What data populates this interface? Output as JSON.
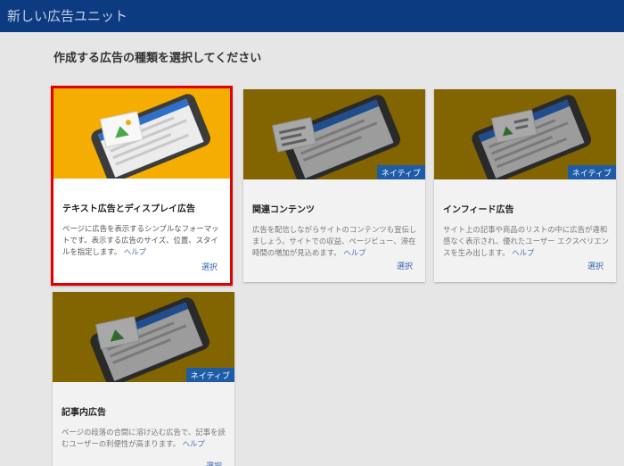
{
  "header": {
    "title": "新しい広告ユニット"
  },
  "page": {
    "heading": "作成する広告の種類を選択してください"
  },
  "cards": [
    {
      "title": "テキスト広告とディスプレイ広告",
      "description": "ページに広告を表示するシンプルなフォーマットです。表示する広告のサイズ、位置、スタイルを指定します。",
      "help": "ヘルプ",
      "select": "選択",
      "badge": "",
      "selected": true
    },
    {
      "title": "関連コンテンツ",
      "description": "広告を配信しながらサイトのコンテンツも宣伝しましょう。サイトでの収益、ページビュー、滞在時間の増加が見込めます。",
      "help": "ヘルプ",
      "select": "選択",
      "badge": "ネイティブ",
      "selected": false
    },
    {
      "title": "インフィード広告",
      "description": "サイト上の記事や商品のリストの中に広告が違和感なく表示され、優れたユーザー エクスペリエンスを生み出します。",
      "help": "ヘルプ",
      "select": "選択",
      "badge": "ネイティブ",
      "selected": false
    },
    {
      "title": "記事内広告",
      "description": "ページの段落の合間に溶け込む広告で、記事を読むユーザーの利便性が高まります。",
      "help": "ヘルプ",
      "select": "選択",
      "badge": "ネイティブ",
      "selected": false
    }
  ],
  "colors": {
    "header": "#0d3b82",
    "selected_border": "#e00000",
    "selected_illustration": "#f4ad00",
    "dimmed_illustration": "#826500",
    "badge": "#1f5ca8",
    "link": "#3a66b0"
  }
}
